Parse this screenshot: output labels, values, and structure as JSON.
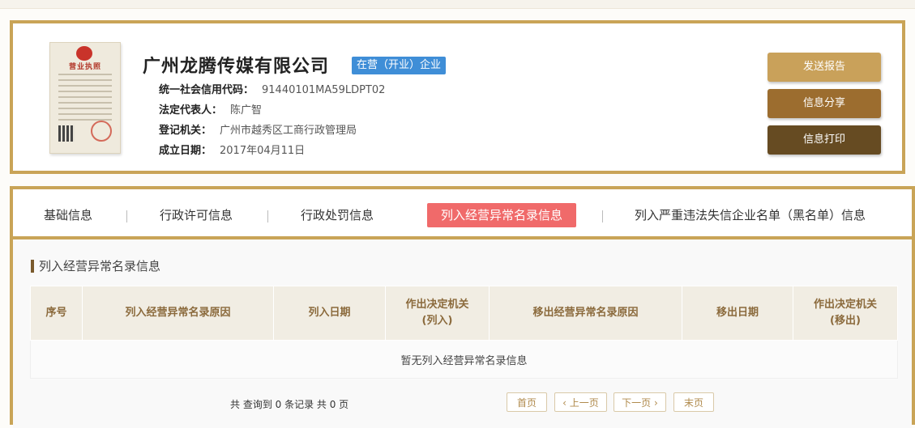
{
  "company": {
    "license_title": "营业执照",
    "name": "广州龙腾传媒有限公司",
    "status": "在营（开业）企业",
    "fields": [
      {
        "label": "统一社会信用代码：",
        "value": "91440101MA59LDPT02"
      },
      {
        "label": "法定代表人：",
        "value": "陈广智"
      },
      {
        "label": "登记机关：",
        "value": "广州市越秀区工商行政管理局"
      },
      {
        "label": "成立日期：",
        "value": "2017年04月11日"
      }
    ]
  },
  "actions": {
    "report": "发送报告",
    "share": "信息分享",
    "print": "信息打印"
  },
  "tabs": [
    {
      "label": "基础信息"
    },
    {
      "label": "行政许可信息"
    },
    {
      "label": "行政处罚信息"
    },
    {
      "label": "列入经营异常名录信息",
      "active": true
    },
    {
      "label": "列入严重违法失信企业名单（黑名单）信息"
    }
  ],
  "section": {
    "title": "列入经营异常名录信息",
    "columns": [
      "序号",
      "列入经营异常名录原因",
      "列入日期",
      "作出决定机关(列入)",
      "移出经营异常名录原因",
      "移出日期",
      "作出决定机关(移出)"
    ],
    "empty": "暂无列入经营异常名录信息"
  },
  "pagination": {
    "summary": "共 查询到 0 条记录 共 0 页",
    "first": "首页",
    "prev": "上一页",
    "next": "下一页",
    "last": "末页"
  },
  "colors": {
    "border_gold": "#c9a457",
    "status_blue": "#3f8ed7",
    "active_tab": "#f06a6a",
    "btn_report": "#c9a15a",
    "btn_share": "#9c6d2f",
    "btn_print": "#664b22"
  }
}
